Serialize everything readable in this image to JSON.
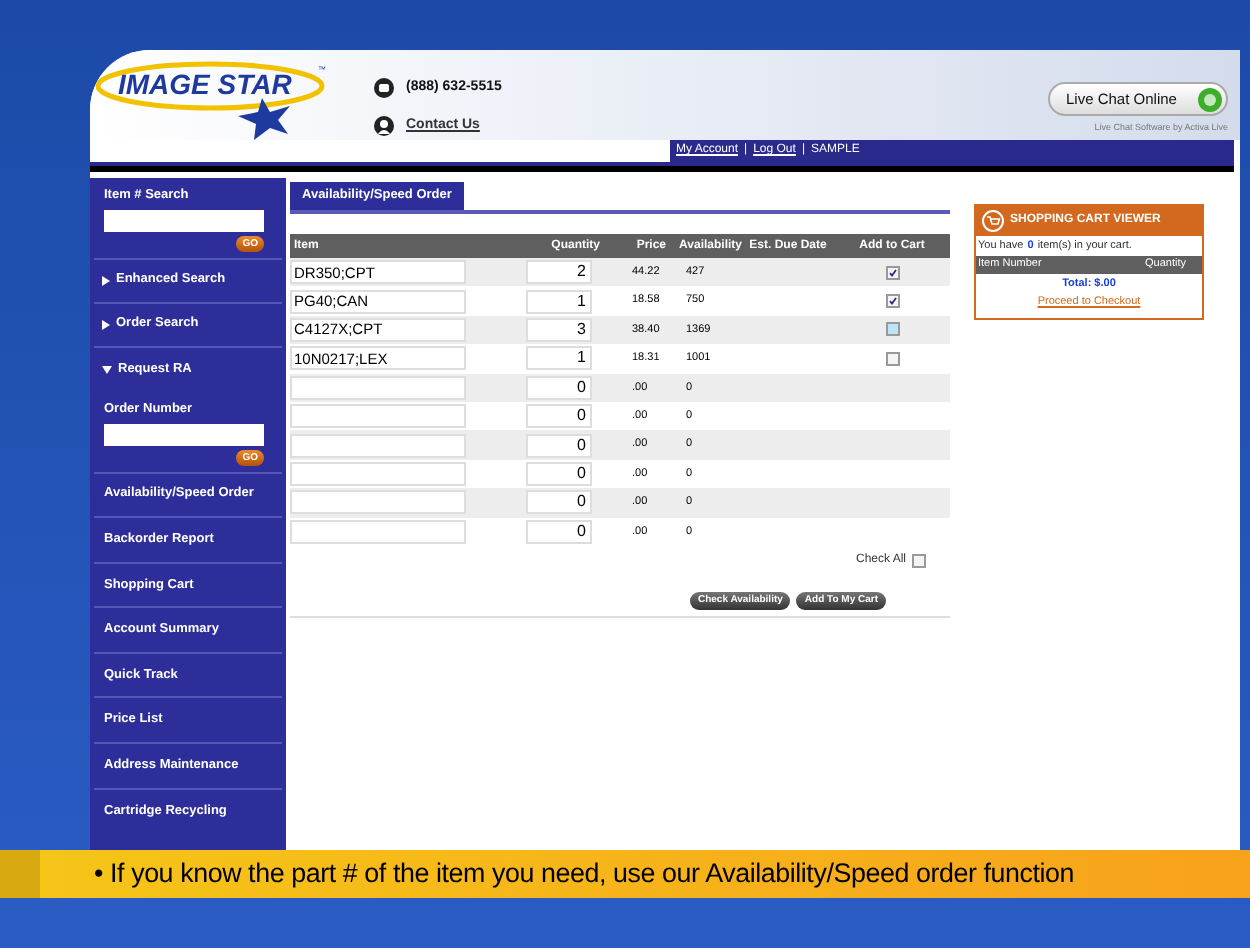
{
  "logo": {
    "text": "IMAGE STAR",
    "tm": "™"
  },
  "contact": {
    "phone": "(888) 632-5515",
    "link": "Contact Us"
  },
  "live_chat": {
    "button": "Live Chat Online",
    "caption": "Live Chat Software by Activa Live"
  },
  "nav": {
    "links": [
      "My Account",
      "Log Out"
    ],
    "separator": "|",
    "user": "SAMPLE"
  },
  "sidebar": {
    "items": [
      {
        "kind": "search",
        "label": "Item # Search",
        "button": "GO"
      },
      {
        "kind": "toggle",
        "label": "Enhanced Search",
        "expanded": false
      },
      {
        "kind": "toggle",
        "label": "Order Search",
        "expanded": false
      },
      {
        "kind": "toggle",
        "label": "Request RA",
        "expanded": true
      },
      {
        "kind": "search",
        "label": "Order Number",
        "button": "GO"
      },
      {
        "kind": "link",
        "label": "Availability/Speed Order"
      },
      {
        "kind": "link",
        "label": "Backorder Report"
      },
      {
        "kind": "link",
        "label": "Shopping Cart"
      },
      {
        "kind": "link",
        "label": "Account Summary"
      },
      {
        "kind": "link",
        "label": "Quick Track"
      },
      {
        "kind": "link",
        "label": "Price List"
      },
      {
        "kind": "link",
        "label": "Address Maintenance"
      },
      {
        "kind": "link",
        "label": "Cartridge Recycling"
      }
    ]
  },
  "tabs": [
    {
      "label": "Availability/Speed Order",
      "selected": true
    }
  ],
  "table": {
    "columns": [
      "Item",
      "Quantity",
      "Price",
      "Availability",
      "Est. Due Date",
      "Add to Cart"
    ],
    "rows": [
      {
        "item": "DR350;CPT",
        "quantity": "2",
        "price": "44.22",
        "availability": "427",
        "checked": true,
        "focused": false
      },
      {
        "item": "PG40;CAN",
        "quantity": "1",
        "price": "18.58",
        "availability": "750",
        "checked": true,
        "focused": false
      },
      {
        "item": "C4127X;CPT",
        "quantity": "3",
        "price": "38.40",
        "availability": "1369",
        "checked": false,
        "focused": true
      },
      {
        "item": "10N0217;LEX",
        "quantity": "1",
        "price": "18.31",
        "availability": "1001",
        "checked": false,
        "focused": false
      },
      {
        "item": "",
        "quantity": "0",
        "price": ".00",
        "availability": "0"
      },
      {
        "item": "",
        "quantity": "0",
        "price": ".00",
        "availability": "0"
      },
      {
        "item": "",
        "quantity": "0",
        "price": ".00",
        "availability": "0"
      },
      {
        "item": "",
        "quantity": "0",
        "price": ".00",
        "availability": "0"
      },
      {
        "item": "",
        "quantity": "0",
        "price": ".00",
        "availability": "0"
      },
      {
        "item": "",
        "quantity": "0",
        "price": ".00",
        "availability": "0"
      }
    ]
  },
  "check_all": {
    "label": "Check All",
    "checked": false
  },
  "buttons": [
    "Check Availability",
    "Add To My Cart"
  ],
  "cart_viewer": {
    "title": "SHOPPING CART VIEWER",
    "message_before": "You have",
    "count": "0",
    "message_after": "item(s) in your cart.",
    "columns": [
      "Item Number",
      "Quantity"
    ],
    "total": "Total: $.00",
    "checkout": "Proceed to Checkout"
  },
  "banner": {
    "text": "• If you know the part # of the item you need, use our Availability/Speed order function"
  }
}
